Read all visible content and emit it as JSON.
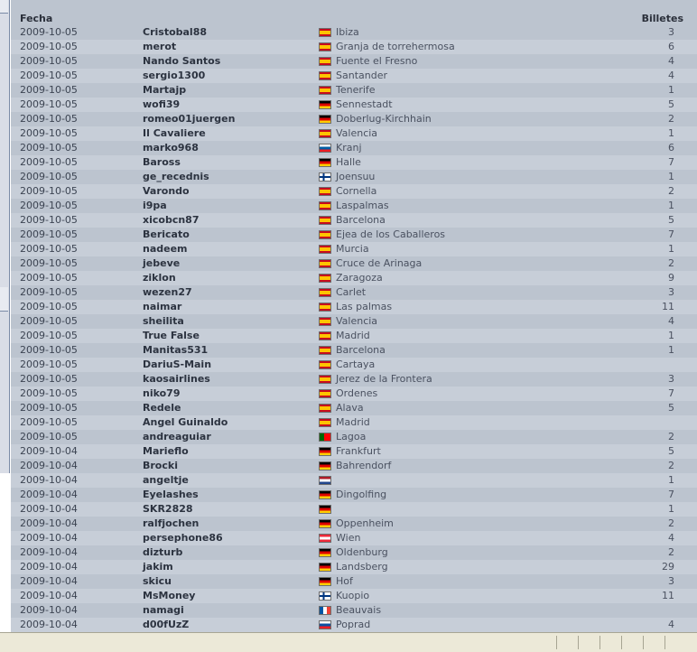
{
  "header": {
    "date_label": "Fecha",
    "tickets_label": "Billetes"
  },
  "rows": [
    {
      "date": "2009-10-05",
      "user": "Cristobal88",
      "flag": "es-flag",
      "city": "Ibiza",
      "tickets": "3"
    },
    {
      "date": "2009-10-05",
      "user": "merot",
      "flag": "es-flag",
      "city": "Granja de torrehermosa",
      "tickets": "6"
    },
    {
      "date": "2009-10-05",
      "user": "Nando Santos",
      "flag": "es-flag",
      "city": "Fuente el Fresno",
      "tickets": "4"
    },
    {
      "date": "2009-10-05",
      "user": "sergio1300",
      "flag": "es-flag",
      "city": "Santander",
      "tickets": "4"
    },
    {
      "date": "2009-10-05",
      "user": "Martajp",
      "flag": "es-flag",
      "city": "Tenerife",
      "tickets": "1"
    },
    {
      "date": "2009-10-05",
      "user": "wofi39",
      "flag": "de-flag",
      "city": "Sennestadt",
      "tickets": "5"
    },
    {
      "date": "2009-10-05",
      "user": "romeo01juergen",
      "flag": "de-flag",
      "city": "Doberlug-Kirchhain",
      "tickets": "2"
    },
    {
      "date": "2009-10-05",
      "user": "Il Cavaliere",
      "flag": "es-flag",
      "city": "Valencia",
      "tickets": "1"
    },
    {
      "date": "2009-10-05",
      "user": "marko968",
      "flag": "si-flag",
      "city": "Kranj",
      "tickets": "6"
    },
    {
      "date": "2009-10-05",
      "user": "Baross",
      "flag": "de-flag",
      "city": "Halle",
      "tickets": "7"
    },
    {
      "date": "2009-10-05",
      "user": "ge_recednis",
      "flag": "fi-flag",
      "city": "Joensuu",
      "tickets": "1"
    },
    {
      "date": "2009-10-05",
      "user": "Varondo",
      "flag": "es-flag",
      "city": "Cornella",
      "tickets": "2"
    },
    {
      "date": "2009-10-05",
      "user": "i9pa",
      "flag": "es-flag",
      "city": "Laspalmas",
      "tickets": "1"
    },
    {
      "date": "2009-10-05",
      "user": "xicobcn87",
      "flag": "es-flag",
      "city": "Barcelona",
      "tickets": "5"
    },
    {
      "date": "2009-10-05",
      "user": "Bericato",
      "flag": "es-flag",
      "city": "Ejea de los Caballeros",
      "tickets": "7"
    },
    {
      "date": "2009-10-05",
      "user": "nadeem",
      "flag": "es-flag",
      "city": "Murcia",
      "tickets": "1"
    },
    {
      "date": "2009-10-05",
      "user": "jebeve",
      "flag": "es-flag",
      "city": "Cruce de Arinaga",
      "tickets": "2"
    },
    {
      "date": "2009-10-05",
      "user": "ziklon",
      "flag": "es-flag",
      "city": "Zaragoza",
      "tickets": "9"
    },
    {
      "date": "2009-10-05",
      "user": "wezen27",
      "flag": "es-flag",
      "city": "Carlet",
      "tickets": "3"
    },
    {
      "date": "2009-10-05",
      "user": "naimar",
      "flag": "es-flag",
      "city": "Las palmas",
      "tickets": "11"
    },
    {
      "date": "2009-10-05",
      "user": "sheilita",
      "flag": "es-flag",
      "city": "Valencia",
      "tickets": "4"
    },
    {
      "date": "2009-10-05",
      "user": "True False",
      "flag": "es-flag",
      "city": "Madrid",
      "tickets": "1"
    },
    {
      "date": "2009-10-05",
      "user": "Manitas531",
      "flag": "es-flag",
      "city": "Barcelona",
      "tickets": "1"
    },
    {
      "date": "2009-10-05",
      "user": "DariuS-Main",
      "flag": "es-flag",
      "city": "Cartaya",
      "tickets": ""
    },
    {
      "date": "2009-10-05",
      "user": "kaosairlines",
      "flag": "es-flag",
      "city": "Jerez de la Frontera",
      "tickets": "3"
    },
    {
      "date": "2009-10-05",
      "user": "niko79",
      "flag": "es-flag",
      "city": "Ordenes",
      "tickets": "7"
    },
    {
      "date": "2009-10-05",
      "user": "Redele",
      "flag": "es-flag",
      "city": "Alava",
      "tickets": "5"
    },
    {
      "date": "2009-10-05",
      "user": "Angel Guinaldo",
      "flag": "es-flag",
      "city": "Madrid",
      "tickets": ""
    },
    {
      "date": "2009-10-05",
      "user": "andreaguiar",
      "flag": "pt-flag",
      "city": "Lagoa",
      "tickets": "2"
    },
    {
      "date": "2009-10-04",
      "user": "Marieflo",
      "flag": "de-flag",
      "city": "Frankfurt",
      "tickets": "5"
    },
    {
      "date": "2009-10-04",
      "user": "Brocki",
      "flag": "de-flag",
      "city": "Bahrendorf",
      "tickets": "2"
    },
    {
      "date": "2009-10-04",
      "user": "angeltje",
      "flag": "nl-flag",
      "city": "",
      "tickets": "1"
    },
    {
      "date": "2009-10-04",
      "user": "Eyelashes",
      "flag": "de-flag",
      "city": "Dingolfing",
      "tickets": "7"
    },
    {
      "date": "2009-10-04",
      "user": "SKR2828",
      "flag": "de-flag",
      "city": "",
      "tickets": "1"
    },
    {
      "date": "2009-10-04",
      "user": "ralfjochen",
      "flag": "de-flag",
      "city": "Oppenheim",
      "tickets": "2"
    },
    {
      "date": "2009-10-04",
      "user": "persephone86",
      "flag": "at-flag",
      "city": "Wien",
      "tickets": "4"
    },
    {
      "date": "2009-10-04",
      "user": "dizturb",
      "flag": "de-flag",
      "city": "Oldenburg",
      "tickets": "2"
    },
    {
      "date": "2009-10-04",
      "user": "jakim",
      "flag": "de-flag",
      "city": "Landsberg",
      "tickets": "29"
    },
    {
      "date": "2009-10-04",
      "user": "skicu",
      "flag": "de-flag",
      "city": "Hof",
      "tickets": "3"
    },
    {
      "date": "2009-10-04",
      "user": "MsMoney",
      "flag": "fi-flag",
      "city": "Kuopio",
      "tickets": "11"
    },
    {
      "date": "2009-10-04",
      "user": "namagi",
      "flag": "fr-flag",
      "city": "Beauvais",
      "tickets": ""
    },
    {
      "date": "2009-10-04",
      "user": "d00fUzZ",
      "flag": "sk-flag",
      "city": "Poprad",
      "tickets": "4"
    }
  ]
}
